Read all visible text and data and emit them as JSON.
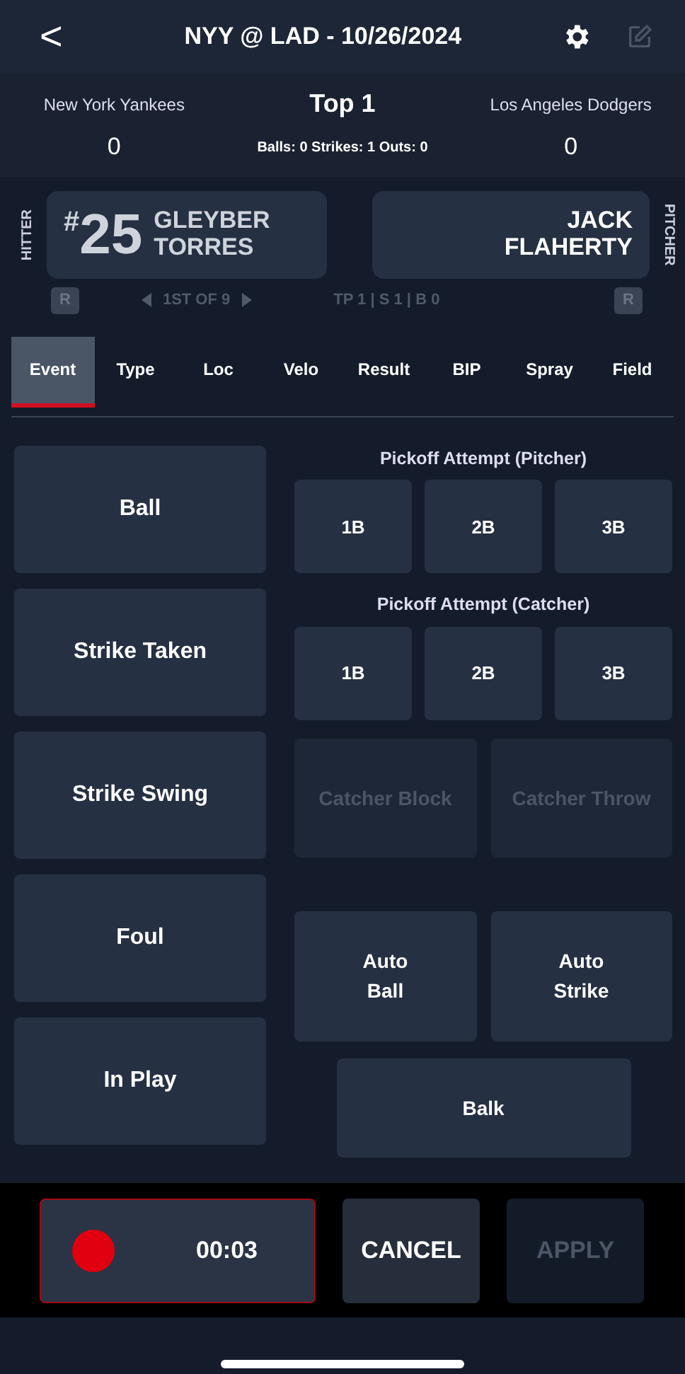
{
  "header": {
    "back": "<",
    "title": "NYY @ LAD - 10/26/2024",
    "edit_disabled": true
  },
  "score": {
    "away_team": "New York Yankees",
    "inning": "Top 1",
    "home_team": "Los Angeles Dodgers",
    "away_score": "0",
    "count": "Balls: 0 Strikes: 1 Outs: 0",
    "home_score": "0"
  },
  "hitter": {
    "side_label": "HITTER",
    "number": "$^{#}$25",
    "first_name": "GLEYBER",
    "last_name": "TORRES",
    "hand": "R"
  },
  "pitcher": {
    "side_label": "PITCHER",
    "first_name": "JACK",
    "last_name": "FLAHERTY",
    "hand": "R"
  },
  "lineup": {
    "order": "1ST OF 9"
  },
  "pitch_info": "TP 1 | S 1 | B 0",
  "tabs": [
    {
      "label": "Event",
      "selected": true
    },
    {
      "label": "Type",
      "selected": false
    },
    {
      "label": "Loc",
      "selected": false
    },
    {
      "label": "Velo",
      "selected": false
    },
    {
      "label": "Result",
      "selected": false
    },
    {
      "label": "BIP",
      "selected": false
    },
    {
      "label": "Spray",
      "selected": false
    },
    {
      "label": "Field",
      "selected": false
    }
  ],
  "events": [
    "Ball",
    "Strike Taken",
    "Strike Swing",
    "Foul",
    "In Play"
  ],
  "pickoff_groups": [
    {
      "title": "Pickoff Attempt (Pitcher)",
      "bases": [
        "1B",
        "2B",
        "3B"
      ]
    },
    {
      "title": "Pickoff Attempt (Catcher)",
      "bases": [
        "1B",
        "2B",
        "3B"
      ]
    }
  ],
  "catcher_actions": [
    {
      "label": "Catcher Block",
      "disabled": true
    },
    {
      "label": "Catcher Throw",
      "disabled": true
    }
  ],
  "auto_actions": [
    "Auto\nBall",
    "Auto\nStrike"
  ],
  "balk": "Balk",
  "footer": {
    "recording": true,
    "timer": "00:03",
    "cancel": "CANCEL",
    "apply": "APPLY",
    "apply_disabled": true
  }
}
